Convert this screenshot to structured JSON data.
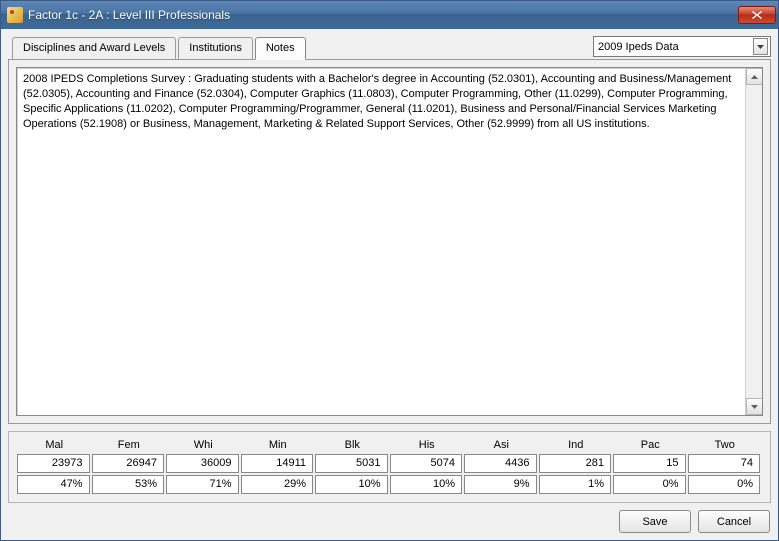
{
  "window": {
    "title": "Factor 1c - 2A : Level III Professionals"
  },
  "tabs": [
    {
      "label": "Disciplines and Award Levels"
    },
    {
      "label": "Institutions"
    },
    {
      "label": "Notes"
    }
  ],
  "active_tab_index": 2,
  "dropdown": {
    "selected": "2009 Ipeds Data"
  },
  "notes_text": "2008 IPEDS Completions Survey : Graduating students with a Bachelor's degree in Accounting (52.0301), Accounting and Business/Management (52.0305), Accounting and Finance (52.0304), Computer Graphics (11.0803), Computer Programming, Other (11.0299), Computer Programming, Specific Applications (11.0202), Computer Programming/Programmer, General (11.0201), Business and Personal/Financial Services Marketing Operations (52.1908) or Business, Management, Marketing & Related Support Services, Other (52.9999) from all US institutions.",
  "columns": [
    "Mal",
    "Fem",
    "Whi",
    "Min",
    "Blk",
    "His",
    "Asi",
    "Ind",
    "Pac",
    "Two"
  ],
  "row_counts": [
    "23973",
    "26947",
    "36009",
    "14911",
    "5031",
    "5074",
    "4436",
    "281",
    "15",
    "74"
  ],
  "row_pcts": [
    "47%",
    "53%",
    "71%",
    "29%",
    "10%",
    "10%",
    "9%",
    "1%",
    "0%",
    "0%"
  ],
  "buttons": {
    "save": "Save",
    "cancel": "Cancel"
  }
}
